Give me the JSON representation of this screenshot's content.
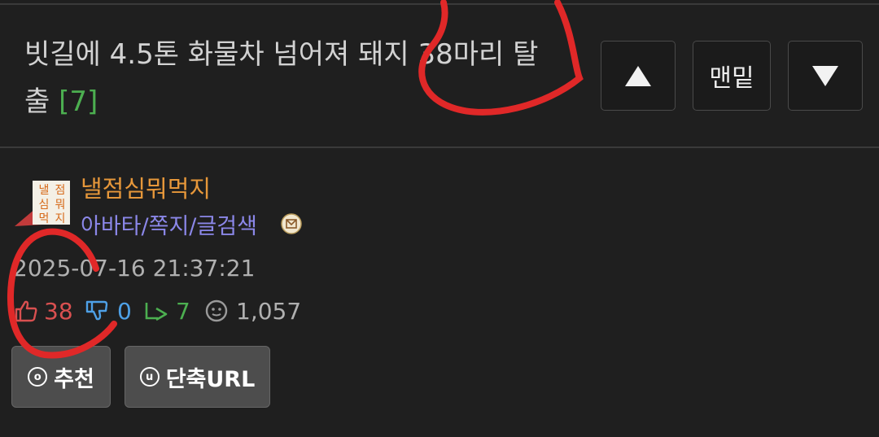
{
  "post": {
    "title": "빗길에 4.5톤 화물차 넘어져 돼지 38마리 탈출",
    "comment_count": "[7]"
  },
  "nav": {
    "bottom_label": "맨밑"
  },
  "author": {
    "nickname": "낼점심뭐먹지",
    "links": "아바타/쪽지/글검색",
    "avatar_text": "낼점심뭐먹지"
  },
  "meta": {
    "date": "2025-07-16 21:37:21",
    "upvotes": "38",
    "downvotes": "0",
    "shares": "7",
    "views": "1,057"
  },
  "actions": {
    "recommend_label": "추천",
    "short_url_label": "단축URL"
  },
  "icons": {
    "up": "thumbs-up-icon",
    "down": "thumbs-down-icon",
    "share": "share-icon",
    "views": "face-icon",
    "mail": "mail-icon"
  },
  "colors": {
    "background": "#1f1f1f",
    "nickname": "#e6973a",
    "links": "#8b87e8",
    "upvote": "#d95050",
    "downvote": "#4ea0e6",
    "share": "#4caf50",
    "annotation": "#e02828"
  }
}
